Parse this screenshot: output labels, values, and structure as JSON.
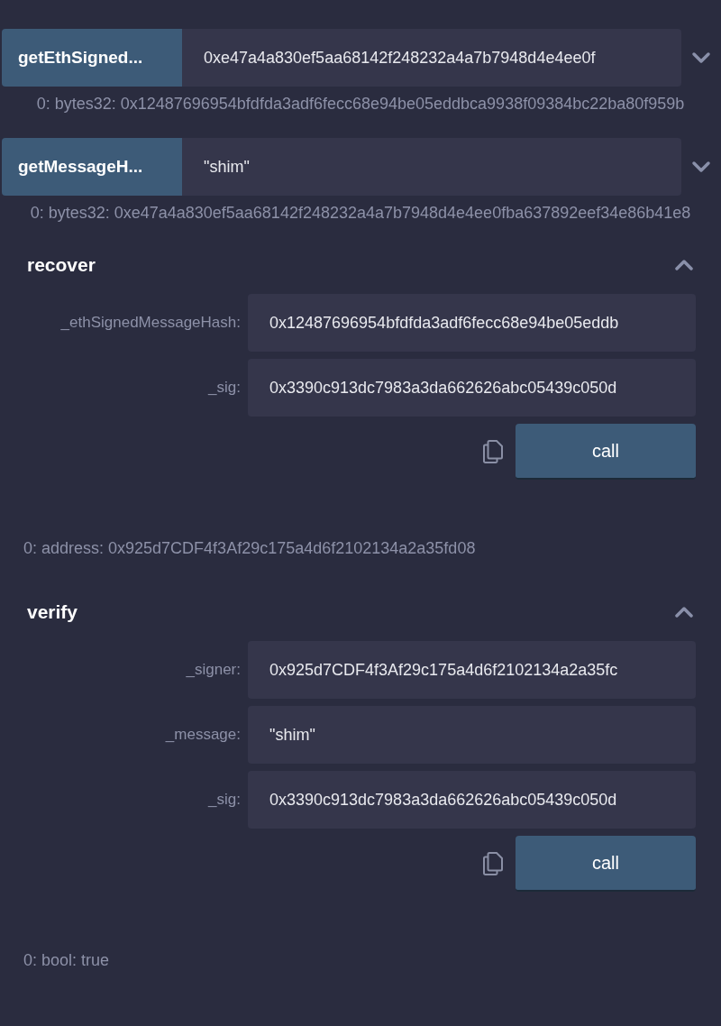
{
  "inline_functions": [
    {
      "name": "getEthSigned...",
      "value": "0xe47a4a830ef5aa68142f248232a4a7b7948d4e4ee0f",
      "expanded": false,
      "output": "0:  bytes32: 0x12487696954bfdfda3adf6fecc68e94be05eddbca9938f09384bc22ba80f959b"
    },
    {
      "name": "getMessageH...",
      "value": "\"shim\"",
      "expanded": false,
      "output": "0:  bytes32: 0xe47a4a830ef5aa68142f248232a4a7b7948d4e4ee0fba637892eef34e86b41e8"
    }
  ],
  "panels": [
    {
      "title": "recover",
      "expanded": true,
      "params": [
        {
          "label": "_ethSignedMessageHash:",
          "value": "0x12487696954bfdfda3adf6fecc68e94be05eddb"
        },
        {
          "label": "_sig:",
          "value": "0x3390c913dc7983a3da662626abc05439c050d"
        }
      ],
      "button": "call",
      "output": "0: address: 0x925d7CDF4f3Af29c175a4d6f2102134a2a35fd08"
    },
    {
      "title": "verify",
      "expanded": true,
      "params": [
        {
          "label": "_signer:",
          "value": "0x925d7CDF4f3Af29c175a4d6f2102134a2a35fc"
        },
        {
          "label": "_message:",
          "value": "\"shim\""
        },
        {
          "label": "_sig:",
          "value": "0x3390c913dc7983a3da662626abc05439c050d"
        }
      ],
      "button": "call",
      "output": "0: bool: true"
    }
  ]
}
